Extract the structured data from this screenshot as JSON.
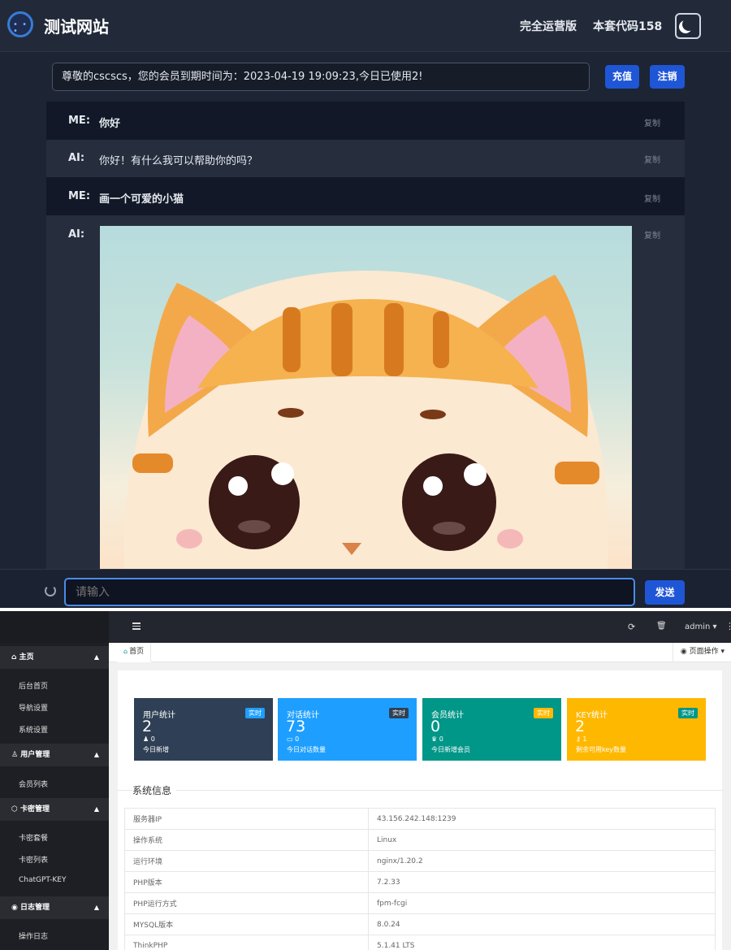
{
  "chat": {
    "site_title": "测试网站",
    "nav": {
      "full_version": "完全运营版",
      "code": "本套代码158"
    },
    "notice": "尊敬的cscscs，您的会员到期时间为：2023-04-19 19:09:23,今日已使用2!",
    "buttons": {
      "recharge": "充值",
      "logout": "注销",
      "send": "发送"
    },
    "copy_label": "复制",
    "messages": [
      {
        "role": "ME:",
        "text": "你好"
      },
      {
        "role": "AI:",
        "text": "你好！有什么我可以帮助你的吗？"
      },
      {
        "role": "ME:",
        "text": "画一个可爱的小猫"
      },
      {
        "role": "AI:",
        "text": ""
      }
    ],
    "input_placeholder": "请输入"
  },
  "admin": {
    "topbar": {
      "user": "admin"
    },
    "sidebar": {
      "groups": [
        {
          "label": "主页",
          "items": [
            "后台首页",
            "导航设置",
            "系统设置"
          ]
        },
        {
          "label": "用户管理",
          "items": [
            "会员列表"
          ]
        },
        {
          "label": "卡密管理",
          "items": [
            "卡密套餐",
            "卡密列表",
            "ChatGPT-KEY"
          ]
        },
        {
          "label": "日志管理",
          "items": [
            "操作日志"
          ]
        }
      ]
    },
    "tabs": {
      "home": "首页",
      "page_ops": "页面操作"
    },
    "cards": [
      {
        "title": "用户统计",
        "badge": "实时",
        "value": "2",
        "sub": "0",
        "desc": "今日新增",
        "color": "#2f4056"
      },
      {
        "title": "对话统计",
        "badge": "实时",
        "value": "73",
        "sub": "0",
        "desc": "今日对话数量",
        "color": "#1e9fff"
      },
      {
        "title": "会员统计",
        "badge": "实时",
        "value": "0",
        "sub": "0",
        "desc": "今日新增会员",
        "color": "#009688"
      },
      {
        "title": "KEY统计",
        "badge": "实时",
        "value": "2",
        "sub": "1",
        "desc": "剩余可用key数量",
        "color": "#ffb800"
      }
    ],
    "system_info": {
      "title": "系统信息",
      "rows": [
        {
          "key": "服务器IP",
          "value": "43.156.242.148:1239"
        },
        {
          "key": "操作系统",
          "value": "Linux"
        },
        {
          "key": "运行环境",
          "value": "nginx/1.20.2"
        },
        {
          "key": "PHP版本",
          "value": "7.2.33"
        },
        {
          "key": "PHP运行方式",
          "value": "fpm-fcgi"
        },
        {
          "key": "MYSQL版本",
          "value": "8.0.24"
        },
        {
          "key": "ThinkPHP",
          "value": "5.1.41 LTS"
        }
      ]
    }
  }
}
